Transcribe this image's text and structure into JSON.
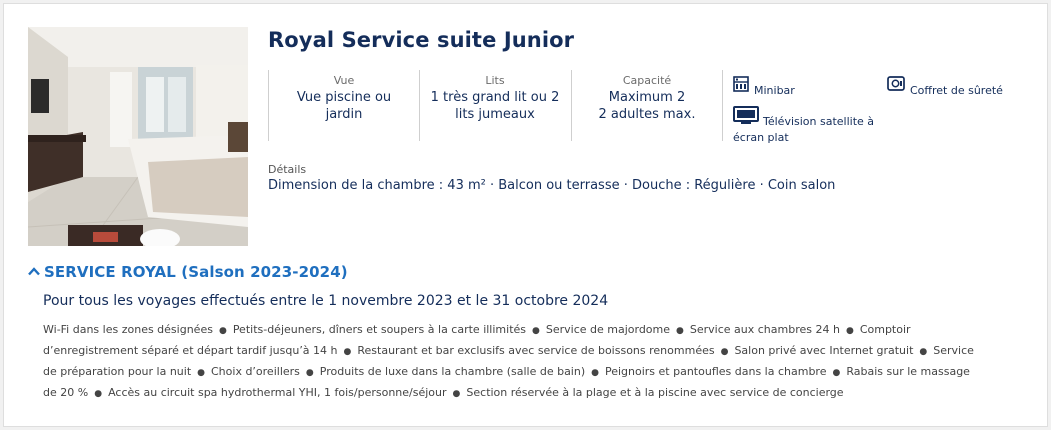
{
  "room": {
    "title": "Royal Service suite Junior"
  },
  "features": [
    {
      "label": "Vue",
      "value": "Vue piscine ou jardin"
    },
    {
      "label": "Lits",
      "value": "1 très grand lit ou 2 lits jumeaux"
    },
    {
      "label": "Capacité",
      "value": "Maximum 2\n2 adultes max."
    }
  ],
  "amenities": [
    {
      "icon": "minibar-icon",
      "label": "Minibar"
    },
    {
      "icon": "safe-icon",
      "label": "Coffret de sûreté"
    },
    {
      "icon": "television-icon",
      "label": "Télévision satellite à écran plat"
    }
  ],
  "details": {
    "label": "Détails",
    "text": "Dimension de la chambre : 43 m² · Balcon ou terrasse · Douche : Régulière · Coin salon"
  },
  "service": {
    "title": "SERVICE ROYAL (Salson 2023-2024)",
    "subtitle": "Pour tous les voyages effectués entre le 1 novembre 2023 et le 31 octobre 2024",
    "items": [
      "Wi-Fi dans les zones désignées",
      "Petits-déjeuners, dîners et soupers à la carte illimités",
      "Service de majordome",
      "Service aux chambres 24 h",
      "Comptoir d’enregistrement séparé et départ tardif jusqu’à 14 h",
      "Restaurant et bar exclusifs avec service de boissons renommées",
      "Salon privé avec Internet gratuit",
      "Service de préparation pour la nuit",
      "Choix d’oreillers",
      "Produits de luxe dans la chambre (salle de bain)",
      "Peignoirs et pantoufles dans la chambre",
      "Rabais sur le massage de 20 %",
      "Accès au circuit spa hydrothermal YHI, 1 fois/personne/séjour",
      "Section réservée à la plage et à la piscine avec service de concierge"
    ],
    "bullet": "●"
  }
}
